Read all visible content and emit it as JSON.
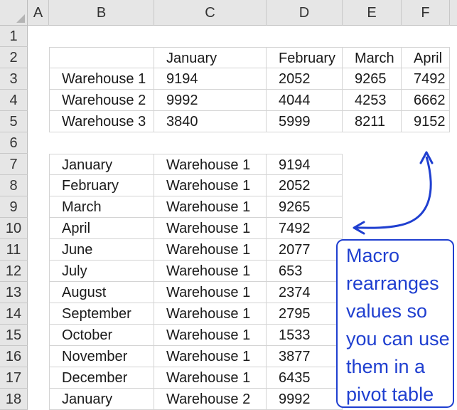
{
  "columns": [
    "A",
    "B",
    "C",
    "D",
    "E",
    "F"
  ],
  "rows": [
    "1",
    "2",
    "3",
    "4",
    "5",
    "6",
    "7",
    "8",
    "9",
    "10",
    "11",
    "12",
    "13",
    "14",
    "15",
    "16",
    "17",
    "18"
  ],
  "table1": {
    "header": [
      "",
      "January",
      "February",
      "March",
      "April"
    ],
    "rows": [
      [
        "Warehouse 1",
        "9194",
        "2052",
        "9265",
        "7492"
      ],
      [
        "Warehouse 2",
        "9992",
        "4044",
        "4253",
        "6662"
      ],
      [
        "Warehouse 3",
        "3840",
        "5999",
        "8211",
        "9152"
      ]
    ]
  },
  "table2": {
    "rows": [
      [
        "January",
        "Warehouse 1",
        "9194"
      ],
      [
        "February",
        "Warehouse 1",
        "2052"
      ],
      [
        "March",
        "Warehouse 1",
        "9265"
      ],
      [
        "April",
        "Warehouse 1",
        "7492"
      ],
      [
        "June",
        "Warehouse 1",
        "2077"
      ],
      [
        "July",
        "Warehouse 1",
        "653"
      ],
      [
        "August",
        "Warehouse 1",
        "2374"
      ],
      [
        "September",
        "Warehouse 1",
        "2795"
      ],
      [
        "October",
        "Warehouse 1",
        "1533"
      ],
      [
        "November",
        "Warehouse 1",
        "3877"
      ],
      [
        "December",
        "Warehouse 1",
        "6435"
      ],
      [
        "January",
        "Warehouse 2",
        "9992"
      ]
    ]
  },
  "callout": {
    "lines": [
      "Macro",
      "rearranges",
      "values so",
      "you can use",
      "them in a",
      "pivot table"
    ]
  },
  "colors": {
    "accent": "#1f3fd0",
    "header_bg": "#e6e6e6",
    "gridline": "#d4d4d4"
  }
}
